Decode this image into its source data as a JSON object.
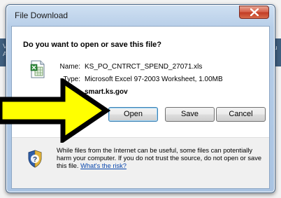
{
  "background": {
    "left_strip_text": "V\nA",
    "right_strip_text": "tu"
  },
  "window": {
    "title": "File Download",
    "question": "Do you want to open or save this file?",
    "file": {
      "name_label": "Name:",
      "name_value": "KS_PO_CNTRCT_SPEND_27071.xls",
      "type_label": "Type:",
      "type_value": "Microsoft Excel 97-2003 Worksheet, 1.00MB",
      "from_label": "om:",
      "from_value": "smart.ks.gov"
    },
    "buttons": {
      "open": "Open",
      "save": "Save",
      "cancel": "Cancel"
    },
    "warning": {
      "text": "While files from the Internet can be useful, some files can potentially harm your computer. If you do not trust the source, do not open or save this file.",
      "link": "What's the risk?"
    }
  },
  "colors": {
    "title_bar": "#b7cee8",
    "close_button": "#c23b24",
    "arrow_fill": "#ffff00",
    "arrow_outline": "#000000",
    "link": "#0645ad"
  },
  "icons": {
    "file": "excel-file-icon",
    "shield": "security-shield-icon",
    "close": "close-icon",
    "pointer": "yellow-arrow-icon"
  }
}
